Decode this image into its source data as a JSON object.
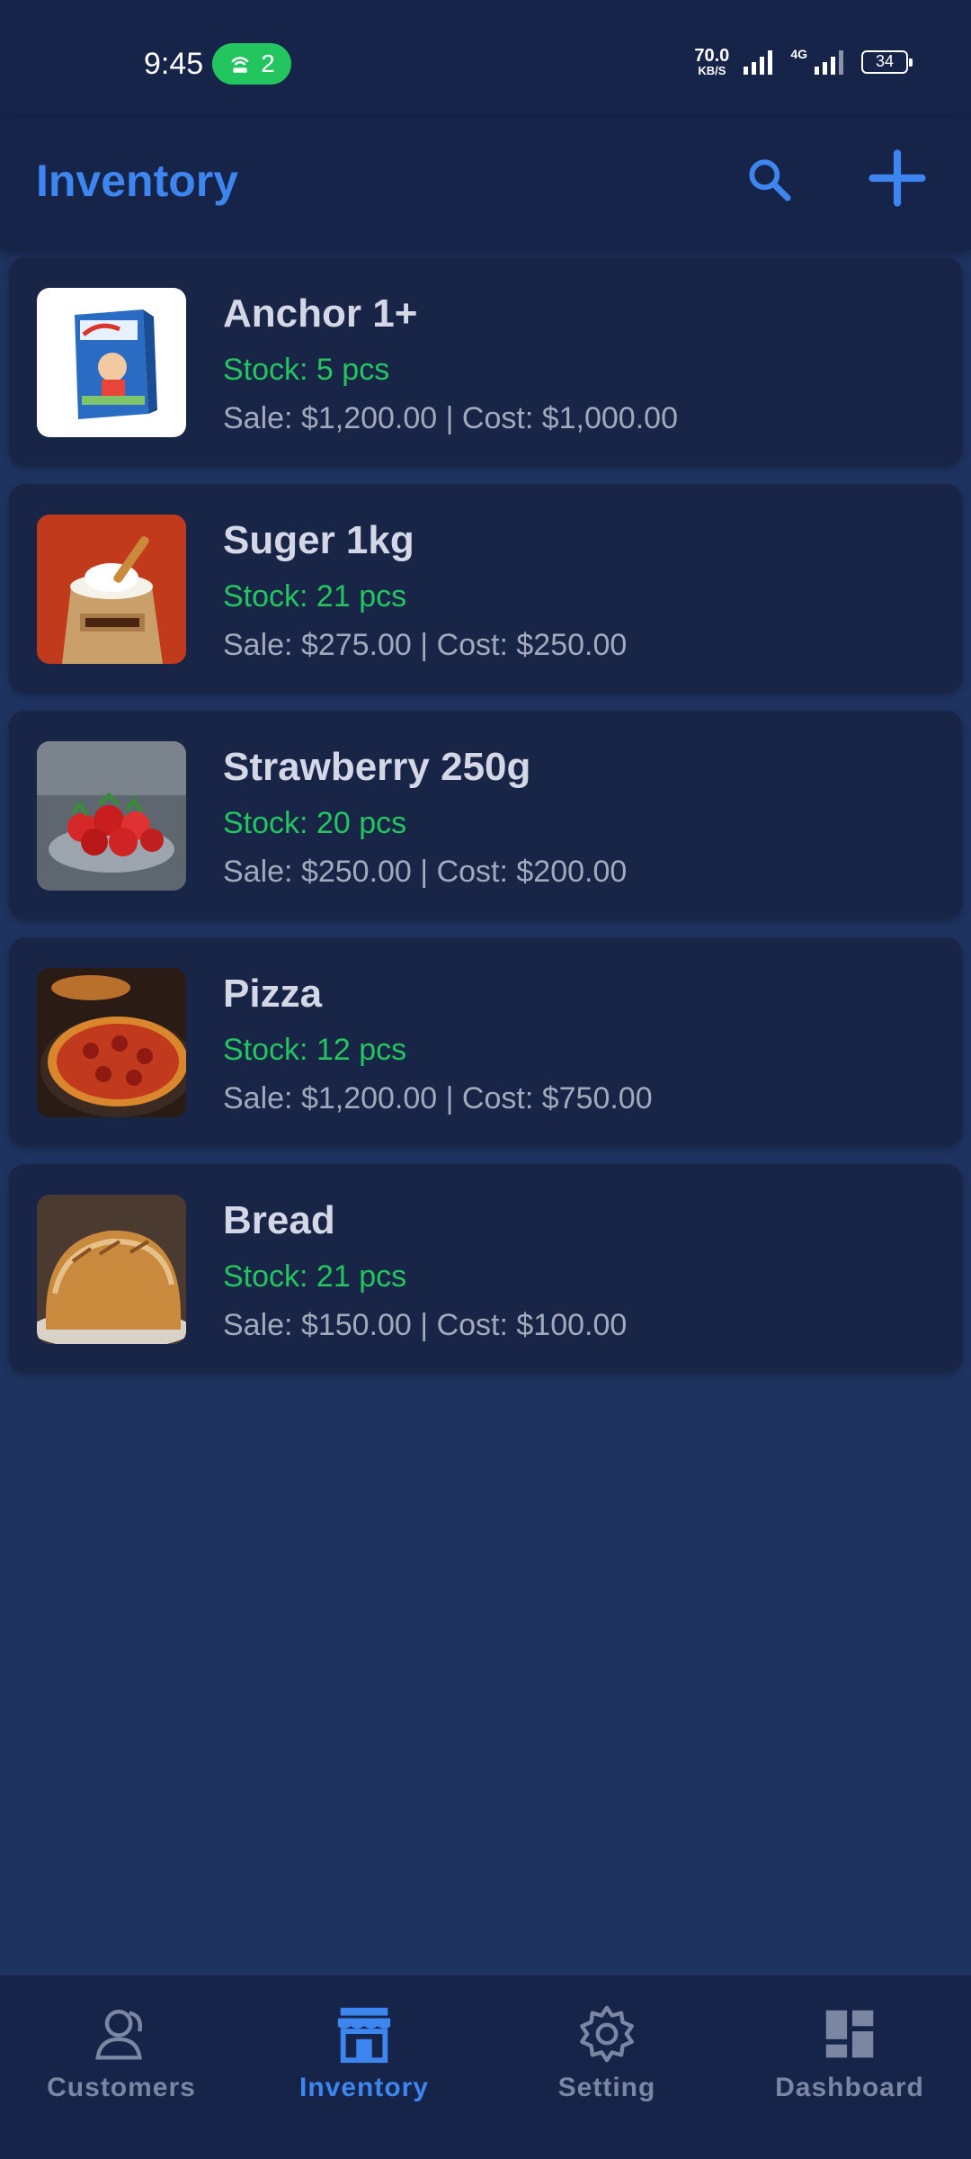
{
  "status_bar": {
    "time": "9:45",
    "hotspot_count": "2",
    "net_speed_value": "70.0",
    "net_speed_unit": "KB/S",
    "network_type": "4G",
    "battery": "34"
  },
  "header": {
    "title": "Inventory",
    "search_icon": "search-icon",
    "add_icon": "plus-icon",
    "accent_color": "#3d86f0"
  },
  "items": [
    {
      "name": "Anchor 1+",
      "stock": "Stock: 5 pcs",
      "price": "Sale: $1,200.00 | Cost: $1,000.00",
      "image": "milk-powder-box"
    },
    {
      "name": "Suger 1kg",
      "stock": "Stock: 21 pcs",
      "price": "Sale: $275.00 | Cost: $250.00",
      "image": "sugar-sack"
    },
    {
      "name": "Strawberry 250g",
      "stock": "Stock: 20 pcs",
      "price": "Sale: $250.00 | Cost: $200.00",
      "image": "strawberries"
    },
    {
      "name": "Pizza",
      "stock": "Stock: 12 pcs",
      "price": "Sale: $1,200.00 | Cost: $750.00",
      "image": "pizza"
    },
    {
      "name": "Bread",
      "stock": "Stock: 21 pcs",
      "price": "Sale: $150.00 | Cost: $100.00",
      "image": "bread"
    }
  ],
  "nav": {
    "customers": "Customers",
    "inventory": "Inventory",
    "setting": "Setting",
    "dashboard": "Dashboard",
    "active": "inventory"
  },
  "colors": {
    "stock_green": "#22c55e",
    "background": "#1f3360",
    "surface": "#182546"
  }
}
